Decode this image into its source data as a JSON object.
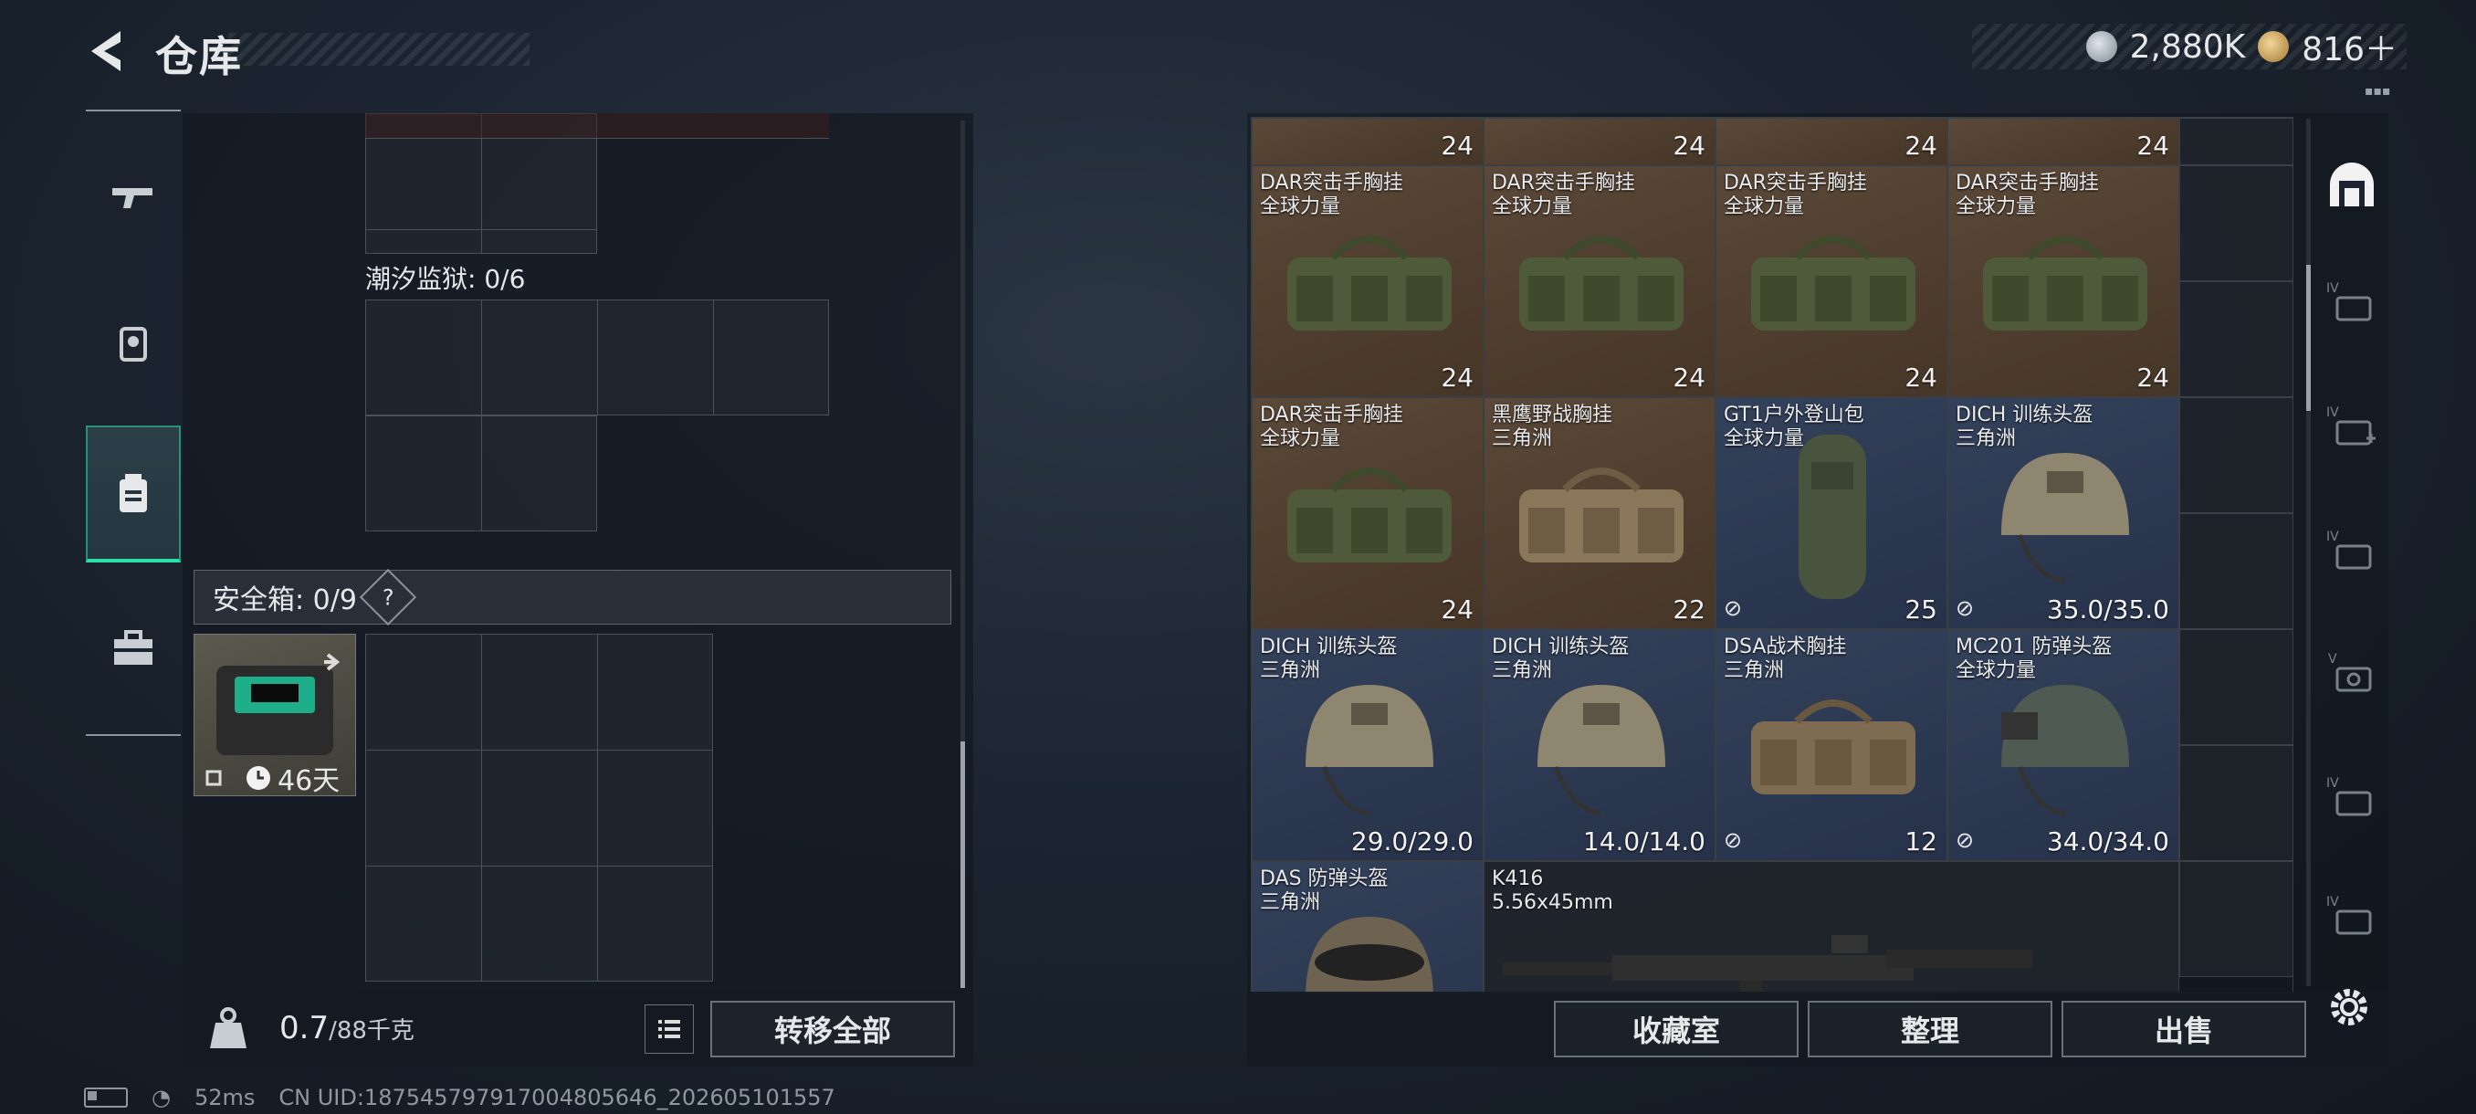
{
  "header": {
    "title": "仓库",
    "currency_silver": "2,880K",
    "currency_gold": "816＋"
  },
  "left_rail": {
    "tabs": [
      "weapons",
      "operator",
      "storage",
      "toolbox"
    ]
  },
  "left_panel": {
    "tide_prison_label": "潮汐监狱: 0/6",
    "safebox_label": "安全箱: 0/9",
    "safebox_help": "?",
    "secure_case_timer": "46天",
    "weight_value": "0.7",
    "weight_capacity": "/88千克",
    "transfer_all_label": "转移全部"
  },
  "items": [
    {
      "name": "DAR突击手胸挂",
      "sub": "全球力量",
      "count": "24"
    },
    {
      "name": "DAR突击手胸挂",
      "sub": "全球力量",
      "count": "24"
    },
    {
      "name": "DAR突击手胸挂",
      "sub": "全球力量",
      "count": "24"
    },
    {
      "name": "DAR突击手胸挂",
      "sub": "全球力量",
      "count": "24"
    },
    {
      "name": "DAR突击手胸挂",
      "sub": "全球力量",
      "count": "24"
    },
    {
      "name": "黑鹰野战胸挂",
      "sub": "三角洲",
      "count": "22"
    },
    {
      "name": "GT1户外登山包",
      "sub": "全球力量",
      "count": "25"
    },
    {
      "name": "DICH 训练头盔",
      "sub": "三角洲",
      "count": "35.0/35.0"
    },
    {
      "name": "DICH 训练头盔",
      "sub": "三角洲",
      "count": "29.0/29.0"
    },
    {
      "name": "DICH 训练头盔",
      "sub": "三角洲",
      "count": "14.0/14.0"
    },
    {
      "name": "DSA战术胸挂",
      "sub": "三角洲",
      "count": "12"
    },
    {
      "name": "MC201 防弹头盔",
      "sub": "全球力量",
      "count": "34.0/34.0"
    },
    {
      "name": "DAS 防弹头盔",
      "sub": "三角洲",
      "count": ""
    },
    {
      "name": "K416",
      "sub": "5.56x45mm",
      "count": ""
    }
  ],
  "top_row_counts": [
    "24",
    "24",
    "24",
    "24"
  ],
  "right_bottom": {
    "collection_label": "收藏室",
    "sort_label": "整理",
    "sell_label": "出售"
  },
  "status_bar": {
    "ping": "52ms",
    "uid": "CN UID:18754579791700480564​6_202605101557"
  },
  "colors": {
    "accent": "#27e1a8",
    "item_bg_brown": "#4f3f30",
    "item_bg_blue": "#2d3a52"
  }
}
